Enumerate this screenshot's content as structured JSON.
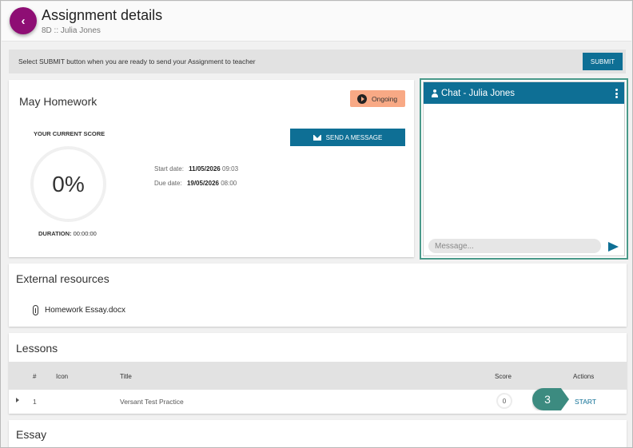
{
  "header": {
    "title": "Assignment details",
    "subtitle": "8D :: Julia Jones",
    "back_glyph": "‹"
  },
  "submit_bar": {
    "text": "Select SUBMIT button when you are ready to send your Assignment to teacher",
    "button_label": "SUBMIT"
  },
  "homework": {
    "title": "May Homework",
    "status": "Ongoing",
    "status_color": "#f8a985",
    "score_label": "YOUR CURRENT SCORE",
    "score": "0%",
    "duration_label": "DURATION:",
    "duration_value": "00:00:00",
    "send_message_label": "SEND A MESSAGE",
    "start_label": "Start date:",
    "start_date": "11/05/2026",
    "start_time": "09:03",
    "due_label": "Due date:",
    "due_date": "19/05/2026",
    "due_time": "08:00"
  },
  "chat": {
    "title": "Chat - Julia Jones",
    "input_placeholder": "Message...",
    "accent_color": "#0e6f95"
  },
  "external_resources": {
    "title": "External resources",
    "files": [
      "Homework Essay.docx"
    ]
  },
  "lessons": {
    "title": "Lessons",
    "columns": [
      "#",
      "Icon",
      "Title",
      "Score",
      "Actions"
    ],
    "rows": [
      {
        "number": "1",
        "title": "Versant Test Practice",
        "score": "0",
        "action": "START"
      }
    ],
    "step_marker": "3"
  },
  "essay": {
    "title": "Essay"
  }
}
